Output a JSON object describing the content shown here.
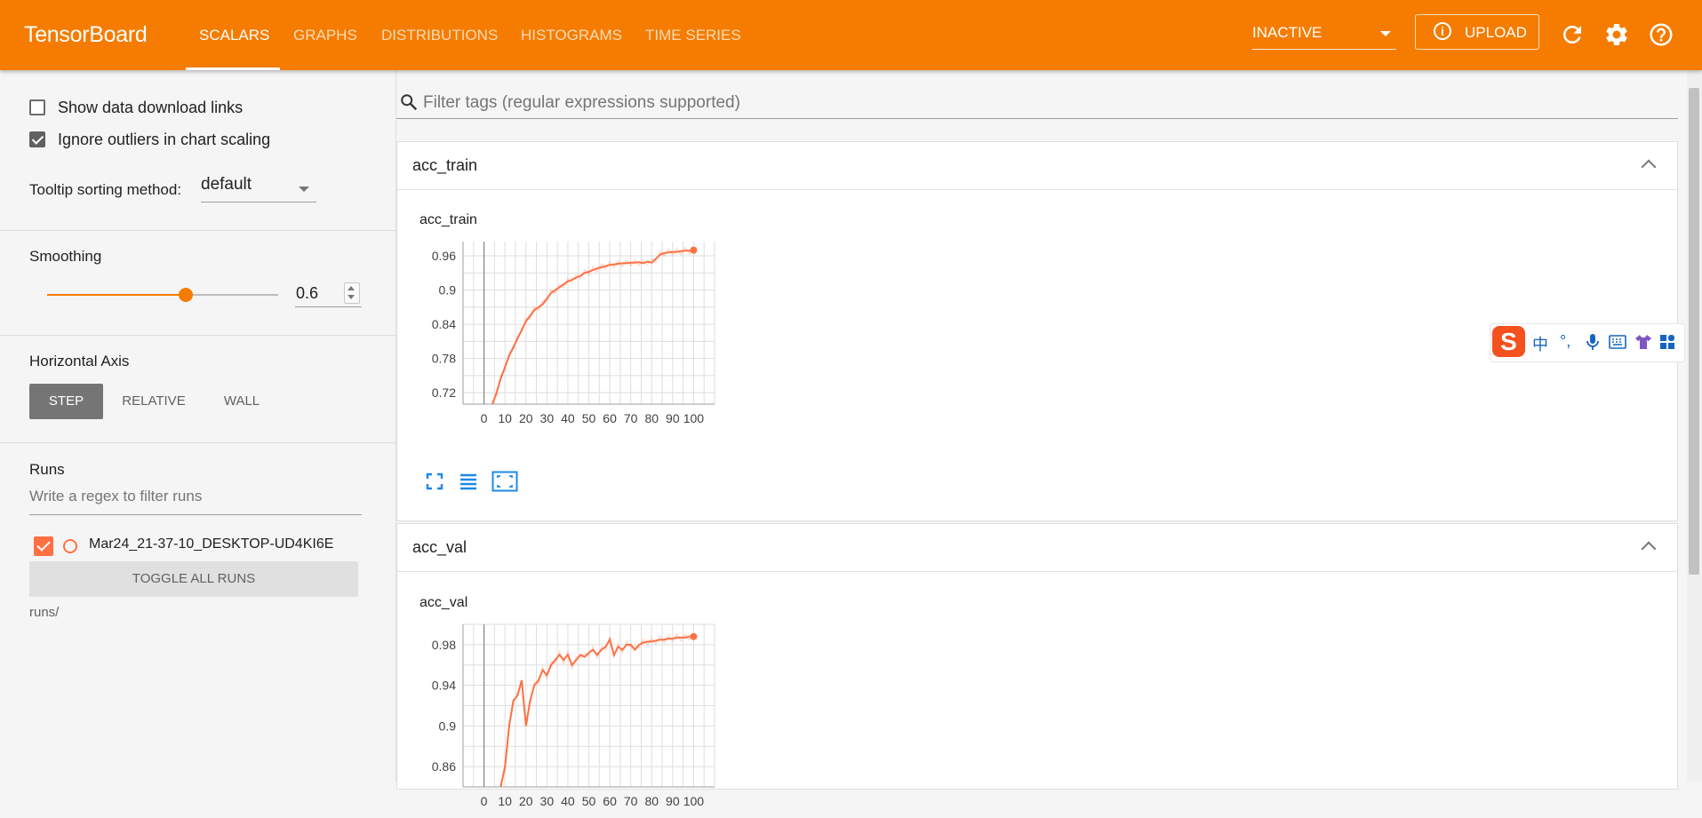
{
  "app": {
    "title": "TensorBoard",
    "tabs": [
      {
        "label": "SCALARS",
        "active": true
      },
      {
        "label": "GRAPHS",
        "active": false
      },
      {
        "label": "DISTRIBUTIONS",
        "active": false
      },
      {
        "label": "HISTOGRAMS",
        "active": false
      },
      {
        "label": "TIME SERIES",
        "active": false
      }
    ],
    "run_status": "INACTIVE",
    "upload_label": "UPLOAD",
    "icons": [
      "refresh-icon",
      "settings-icon",
      "help-icon",
      "info-icon"
    ],
    "accent_color": "#f57c00"
  },
  "sidebar": {
    "show_download_links": {
      "label": "Show data download links",
      "checked": false
    },
    "ignore_outliers": {
      "label": "Ignore outliers in chart scaling",
      "checked": true
    },
    "tooltip_sorting": {
      "label": "Tooltip sorting method:",
      "value": "default"
    },
    "smoothing": {
      "label": "Smoothing",
      "value": "0.6",
      "fraction": 0.6
    },
    "horizontal_axis": {
      "label": "Horizontal Axis",
      "options": [
        {
          "label": "STEP",
          "active": true
        },
        {
          "label": "RELATIVE",
          "active": false
        },
        {
          "label": "WALL",
          "active": false
        }
      ]
    },
    "runs": {
      "label": "Runs",
      "filter_placeholder": "Write a regex to filter runs",
      "items": [
        {
          "name": "Mar24_21-37-10_DESKTOP-UD4KI6E",
          "checked": true,
          "color": "#ff7043"
        }
      ],
      "toggle_all_label": "TOGGLE ALL RUNS",
      "dir": "runs/"
    }
  },
  "main": {
    "filter_placeholder": "Filter tags (regular expressions supported)",
    "cards": [
      {
        "tag": "acc_train",
        "chart_title": "acc_train"
      },
      {
        "tag": "acc_val",
        "chart_title": "acc_val"
      }
    ]
  },
  "ime": {
    "items": [
      "中",
      "°,"
    ]
  },
  "chart_data": [
    {
      "type": "line",
      "title": "acc_train",
      "xlabel": "",
      "ylabel": "",
      "xlim": [
        -10,
        110
      ],
      "ylim": [
        0.7,
        0.985
      ],
      "x_ticks": [
        "0",
        "10",
        "20",
        "30",
        "40",
        "50",
        "60",
        "70",
        "80",
        "90",
        "100"
      ],
      "y_ticks": [
        "0.72",
        "0.78",
        "0.84",
        "0.9",
        "0.96"
      ],
      "grid": true,
      "series": [
        {
          "color": "#ff7043",
          "x": [
            4,
            6,
            8,
            10,
            12,
            14,
            16,
            18,
            20,
            22,
            24,
            26,
            28,
            30,
            32,
            34,
            36,
            38,
            40,
            42,
            44,
            46,
            48,
            50,
            52,
            54,
            56,
            58,
            60,
            62,
            64,
            66,
            68,
            70,
            72,
            74,
            76,
            78,
            80,
            82,
            84,
            86,
            88,
            90,
            92,
            94,
            96,
            98,
            100
          ],
          "y": [
            0.7,
            0.72,
            0.745,
            0.765,
            0.785,
            0.8,
            0.815,
            0.83,
            0.845,
            0.855,
            0.865,
            0.87,
            0.875,
            0.885,
            0.895,
            0.9,
            0.905,
            0.91,
            0.915,
            0.918,
            0.922,
            0.925,
            0.93,
            0.932,
            0.935,
            0.938,
            0.94,
            0.942,
            0.944,
            0.945,
            0.946,
            0.947,
            0.947,
            0.948,
            0.948,
            0.949,
            0.947,
            0.95,
            0.948,
            0.955,
            0.962,
            0.965,
            0.966,
            0.967,
            0.967,
            0.968,
            0.969,
            0.969,
            0.97
          ]
        }
      ]
    },
    {
      "type": "line",
      "title": "acc_val",
      "xlabel": "",
      "ylabel": "",
      "xlim": [
        -10,
        110
      ],
      "ylim": [
        0.84,
        1.0
      ],
      "x_ticks": [
        "0",
        "10",
        "20",
        "30",
        "40",
        "50",
        "60",
        "70",
        "80",
        "90",
        "100"
      ],
      "y_ticks": [
        "0.86",
        "0.9",
        "0.94",
        "0.98"
      ],
      "grid": true,
      "series": [
        {
          "color": "#ff7043",
          "x": [
            8,
            10,
            12,
            14,
            16,
            18,
            20,
            22,
            24,
            26,
            28,
            30,
            32,
            34,
            36,
            38,
            40,
            42,
            44,
            46,
            48,
            50,
            52,
            54,
            56,
            58,
            60,
            62,
            64,
            66,
            68,
            70,
            72,
            74,
            76,
            78,
            80,
            82,
            84,
            86,
            88,
            90,
            92,
            94,
            96,
            98,
            100
          ],
          "y": [
            0.84,
            0.86,
            0.9,
            0.925,
            0.93,
            0.945,
            0.9,
            0.925,
            0.94,
            0.945,
            0.955,
            0.95,
            0.96,
            0.965,
            0.97,
            0.965,
            0.97,
            0.96,
            0.965,
            0.97,
            0.968,
            0.972,
            0.975,
            0.97,
            0.975,
            0.978,
            0.985,
            0.97,
            0.978,
            0.975,
            0.98,
            0.98,
            0.975,
            0.98,
            0.982,
            0.983,
            0.983,
            0.984,
            0.985,
            0.985,
            0.986,
            0.986,
            0.987,
            0.987,
            0.987,
            0.988,
            0.988
          ]
        }
      ]
    }
  ]
}
